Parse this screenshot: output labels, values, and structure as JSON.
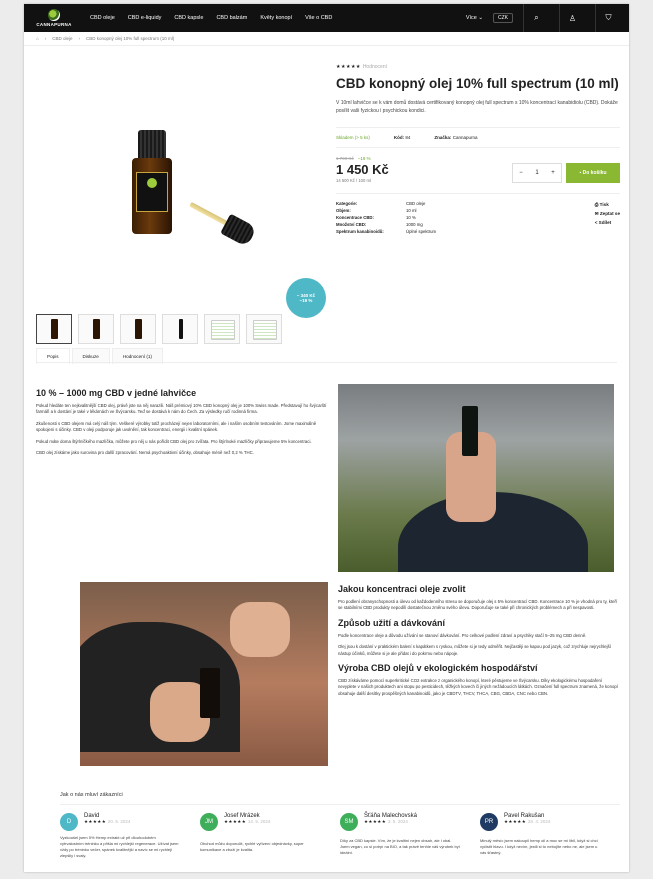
{
  "header": {
    "logo_text": "CANNAPURNA",
    "nav": [
      "CBD oleje",
      "CBD e-liquidy",
      "CBD kapsle",
      "CBD balzám",
      "Květy konopí",
      "Vše o CBD"
    ],
    "more_label": "Více",
    "currency": "CZK"
  },
  "breadcrumbs": [
    "CBD oleje",
    "CBD konopný olej 10% full spectrum (10 ml)"
  ],
  "product": {
    "stars": "★★★★★",
    "review_link": "Hodnocení",
    "title": "CBD konopný olej 10% full spectrum (10 ml)",
    "description": "V 10ml lahvičce se k vám domů dostává certifikovaný konopný olej full spectrum s 10% koncentrací kanabidiolu (CBD). Dokáže posílit vaši fyzickou i psychickou kondici.",
    "stock": "Skladem (> 5 ks)",
    "code_label": "Kód:",
    "code": "84",
    "brand_label": "Značka:",
    "brand": "Cannapurna",
    "old_price": "1 790 Kč",
    "discount": "−19 %",
    "price": "1 450 Kč",
    "price_per": "14 500 Kč / 100 ml",
    "qty": "1",
    "add_to_cart": "Do košíku",
    "sale_badge_line1": "− 340 Kč",
    "sale_badge_line2": "−19 %",
    "specs": [
      {
        "label": "Kategorie:",
        "value": "CBD oleje"
      },
      {
        "label": "Objem:",
        "value": "10 ml"
      },
      {
        "label": "Koncentrace CBD:",
        "value": "10 %"
      },
      {
        "label": "Množství CBD:",
        "value": "1000 mg"
      },
      {
        "label": "Spektrum kanabinoidů:",
        "value": "Úplné spektrum"
      }
    ],
    "actions": [
      "Tisk",
      "Zeptat se",
      "Sdílet"
    ]
  },
  "tabs": [
    "Popis",
    "Diskuze",
    "Hodnocení (1)"
  ],
  "article": {
    "h1": "10 % – 1000 mg CBD v jedné lahvičce",
    "p1": "Pokud hledáte ten nejkvalitnější CBD olej, právě jste na něj narazili. Náš prémiový 10% CBD konopný olej je 100% Swiss made. Představují ho švýcarští farmáři a k dostání je také v lékárnách ve Švýcarsku. Teď se dostává k nám do Čech. Za výsledky ručí rodinná firma.",
    "p2": "Zkušenosti s CBD olejem má celý náš tým. Veškeré výrobky totiž procházejí nejen laboratorními, ale i naším osobním testováním. Jsme maximálně spokojeni s účinky. CBD v oleji podporuje jak uvolnění, tak koncentraci, energii i kvalitní spánek.",
    "p3": "Pokud máte doma štýrlníčkého mazlíčka, můžete pro něj u nás pořídit CBD olej pro zvířata. Pro štýrlnoké mazlíčky připravujeme 5% koncentraci.",
    "p4": "CBD olej získáme jako surovina pro další zpracování. Nemá psychoaktivní účinky, obsahuje méně než 0,2 % THC.",
    "h2": "Jakou koncentraci oleje zvolit",
    "p5": "Pro podlení obranyschopnosti a úlevu od každodenního stresu se doporučuje olej s 5% koncentrací CBD. Koncentrace 10 % je vhodná pro ty, kteří se stabilními CBD produkty nepodílí dostatečnou změnu svého úlevu. Doporučuje se také při chronických problémech a při nespavosti.",
    "h3": "Způsob užití a dávkování",
    "p6": "Podle koncentrace oleje a důvodu užívání se stanoví dávkování. Pro celkové podlení zdraví a psychiky stačí 5–25 mg CBD denně.",
    "p7": "Olej jsou k dostání v praktickém balení s kapátkem s ryskou, můžete si je tedy odměřit. Nejčastěji se kapou pod jazyk, což zrychluje nejrychlejší nástup účinků, můžete si je ale přidat i do pokrmu nebo nápoje.",
    "h4": "Výroba CBD olejů v ekologickém hospodářství",
    "p8": "CBD získáváme pomocí superkritické CO2 extrakce z organického konopí, které pěstujeme ve Švýcarsku. Díky ekologickému hospodaření nevyplete v našich produktech ani stopu po pesticidech, těžkých kovech či jiných nežádoucích látkách. Označení full spectrum znamená, že konopí obsahuje další desítky prospěšných kanabinoidů, jako je CBDTV, THCV, THCA, CBG, CBDA, CNC nebo CBN."
  },
  "reviews": {
    "heading": "Jak o nás mluví zákazníci",
    "items": [
      {
        "initials": "D",
        "name": "David",
        "stars": "★★★★★",
        "date": "20. 5. 2024",
        "color": "#4fb8c6",
        "text": "Vyzkoušel jsem 5% Hemp extrakt už při dlouhodobém vytrvalostním tréninku a přišla mi rychlejší regenerace. Užívat jsem vždy po tréninku večer, spánek kvalitnější a navíc se mi rychleji zlepšily i svaly."
      },
      {
        "initials": "JM",
        "name": "Josef Mrázek",
        "stars": "★★★★★",
        "date": "14. 5. 2024",
        "color": "#3fae5a",
        "text": "Obchod můžu doporučit, rychlé vyřízení objednávky, super komunikace a zboží je kvalita."
      },
      {
        "initials": "SM",
        "name": "Šťáňa Malechovská",
        "stars": "★★★★★",
        "date": "3. 5. 2024",
        "color": "#3fae5a",
        "text": "Díky za CBD kapsle. Vím, že je kvalitní nejen obsah, ale i obal. Jsem vegan, co si potrpí na BIO, a tak právě tenhle váš výrobek byl ideální."
      },
      {
        "initials": "PR",
        "name": "Pavel Rakušan",
        "stars": "★★★★★",
        "date": "28. 4. 2024",
        "color": "#1f3b63",
        "text": "Minulý měsíc jsem nakoupil hemp oil a moc se mi líbil, když si chci vyčistit hlavu. I když nevím, jestli si to nebojíte nebo ne, ale jsem u vás šťastný."
      }
    ]
  }
}
